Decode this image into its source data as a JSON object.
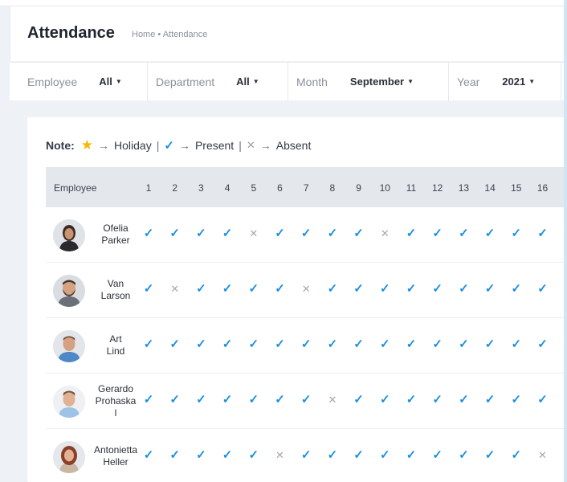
{
  "header": {
    "title": "Attendance",
    "breadcrumb": "Home • Attendance"
  },
  "filters": [
    {
      "label": "Employee",
      "value": "All"
    },
    {
      "label": "Department",
      "value": "All"
    },
    {
      "label": "Month",
      "value": "September"
    },
    {
      "label": "Year",
      "value": "2021"
    }
  ],
  "note": {
    "label": "Note:",
    "holiday": "Holiday",
    "present": "Present",
    "absent": "Absent",
    "separator": "|",
    "arrow": "→"
  },
  "table": {
    "employee_header": "Employee",
    "days": [
      "1",
      "2",
      "3",
      "4",
      "5",
      "6",
      "7",
      "8",
      "9",
      "10",
      "11",
      "12",
      "13",
      "14",
      "15",
      "16"
    ],
    "rows": [
      {
        "name_lines": [
          "Ofelia",
          "Parker"
        ],
        "avatar": "female-avatar-dark-hair",
        "marks": [
          "P",
          "P",
          "P",
          "P",
          "A",
          "P",
          "P",
          "P",
          "P",
          "A",
          "P",
          "P",
          "P",
          "P",
          "P",
          "P"
        ]
      },
      {
        "name_lines": [
          "Van",
          "Larson"
        ],
        "avatar": "male-avatar-beard",
        "marks": [
          "P",
          "A",
          "P",
          "P",
          "P",
          "P",
          "A",
          "P",
          "P",
          "P",
          "P",
          "P",
          "P",
          "P",
          "P",
          "P"
        ]
      },
      {
        "name_lines": [
          "Art",
          "Lind"
        ],
        "avatar": "male-avatar-blue-shirt",
        "marks": [
          "P",
          "P",
          "P",
          "P",
          "P",
          "P",
          "P",
          "P",
          "P",
          "P",
          "P",
          "P",
          "P",
          "P",
          "P",
          "P"
        ]
      },
      {
        "name_lines": [
          "Gerardo",
          "Prohaska",
          "l"
        ],
        "avatar": "male-avatar-light-shirt",
        "marks": [
          "P",
          "P",
          "P",
          "P",
          "P",
          "P",
          "P",
          "A",
          "P",
          "P",
          "P",
          "P",
          "P",
          "P",
          "P",
          "P"
        ]
      },
      {
        "name_lines": [
          "Antonietta",
          "Heller"
        ],
        "avatar": "female-avatar-red-hair",
        "marks": [
          "P",
          "P",
          "P",
          "P",
          "P",
          "A",
          "P",
          "P",
          "P",
          "P",
          "P",
          "P",
          "P",
          "P",
          "P",
          "A"
        ]
      }
    ]
  },
  "colors": {
    "present": "#1a8fe0",
    "absent": "#a3a8b2",
    "holiday": "#f5b800",
    "header_bg": "#e4e7ec"
  }
}
